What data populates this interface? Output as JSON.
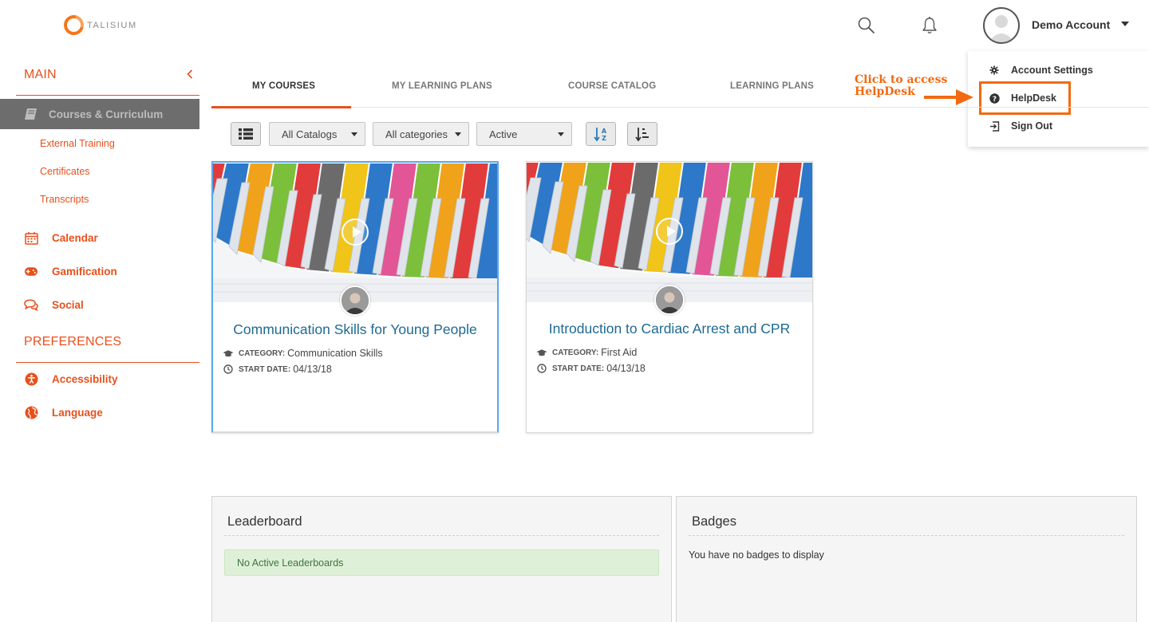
{
  "brand": {
    "name": "TALISIUM",
    "accent": "#e8501b",
    "link": "#1d6a93"
  },
  "header": {
    "search_icon": "search-icon",
    "notifications_icon": "bell-icon",
    "account_name": "Demo Account"
  },
  "account_menu": {
    "items": [
      {
        "label": "Account Settings",
        "icon": "gear-icon"
      },
      {
        "label": "HelpDesk",
        "icon": "question-circle-icon"
      },
      {
        "label": "Sign Out",
        "icon": "sign-out-icon"
      }
    ]
  },
  "annotation": {
    "line1": "Click to access",
    "line2": "HelpDesk"
  },
  "sidebar": {
    "main_heading": "MAIN",
    "active_item": {
      "label": "Courses & Curriculum",
      "icon": "book-icon"
    },
    "sub_items": [
      "External Training",
      "Certificates",
      "Transcripts"
    ],
    "items": [
      {
        "label": "Calendar",
        "icon": "calendar-icon"
      },
      {
        "label": "Gamification",
        "icon": "gamepad-icon"
      },
      {
        "label": "Social",
        "icon": "comments-icon"
      }
    ],
    "preferences_heading": "PREFERENCES",
    "pref_items": [
      {
        "label": "Accessibility",
        "icon": "accessibility-icon"
      },
      {
        "label": "Language",
        "icon": "globe-icon"
      }
    ]
  },
  "tabs": [
    {
      "label": "MY COURSES",
      "active": true
    },
    {
      "label": "MY LEARNING PLANS",
      "active": false
    },
    {
      "label": "COURSE CATALOG",
      "active": false
    },
    {
      "label": "LEARNING PLANS",
      "active": false
    }
  ],
  "filters": {
    "catalog": "All Catalogs",
    "category": "All categories",
    "status": "Active"
  },
  "courses": [
    {
      "title": "Communication Skills for Young People",
      "category_label": "CATEGORY:",
      "category": "Communication Skills",
      "start_label": "START DATE:",
      "start_date": "04/13/18"
    },
    {
      "title": "Introduction to Cardiac Arrest and CPR",
      "category_label": "CATEGORY:",
      "category": "First Aid",
      "start_label": "START DATE:",
      "start_date": "04/13/18"
    }
  ],
  "leaderboard": {
    "title": "Leaderboard",
    "message": "No Active Leaderboards"
  },
  "badges": {
    "title": "Badges",
    "message": "You have no badges to display"
  }
}
